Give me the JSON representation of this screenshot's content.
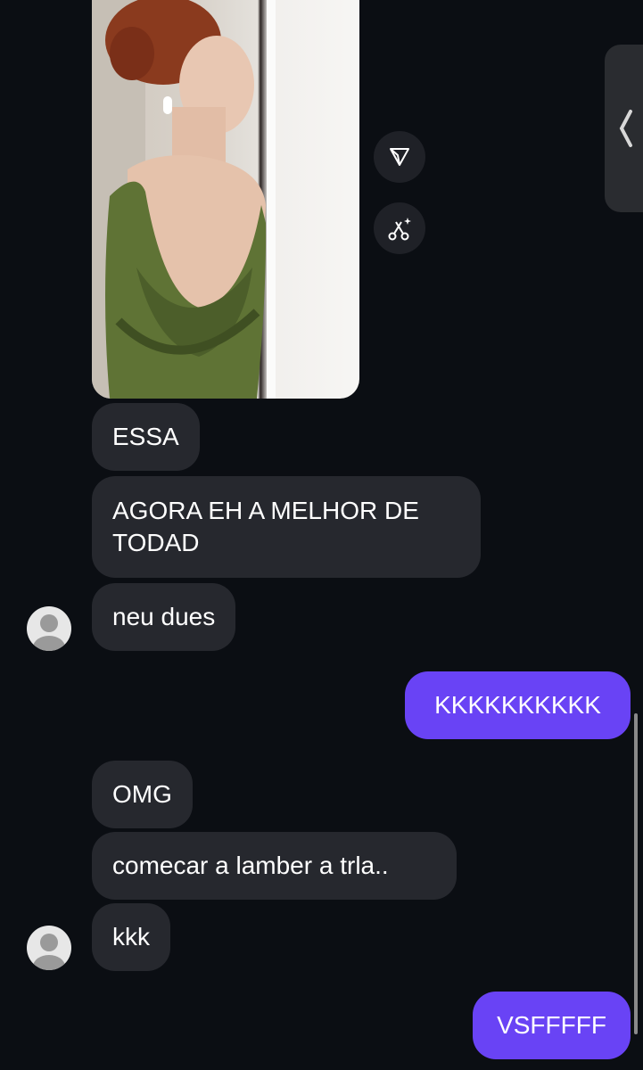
{
  "messages": [
    {
      "text": "ESSA"
    },
    {
      "text": "AGORA EH A MELHOR DE"
    },
    {
      "text": "TODAD"
    },
    {
      "text": "neu dues"
    },
    {
      "text": "KKKKKKKKKK"
    },
    {
      "text": "OMG"
    },
    {
      "text": "comecar a lamber a trla.."
    },
    {
      "text": "kkk"
    },
    {
      "text": "VSFFFFF"
    }
  ],
  "icons": {
    "share": "send-icon",
    "edit": "sparkle-scissors-icon",
    "edge": "chevron-left-icon",
    "avatar": "person-icon"
  },
  "colors": {
    "background": "#0b0e13",
    "incoming_bubble": "#26282e",
    "outgoing_bubble": "#6943f5"
  }
}
